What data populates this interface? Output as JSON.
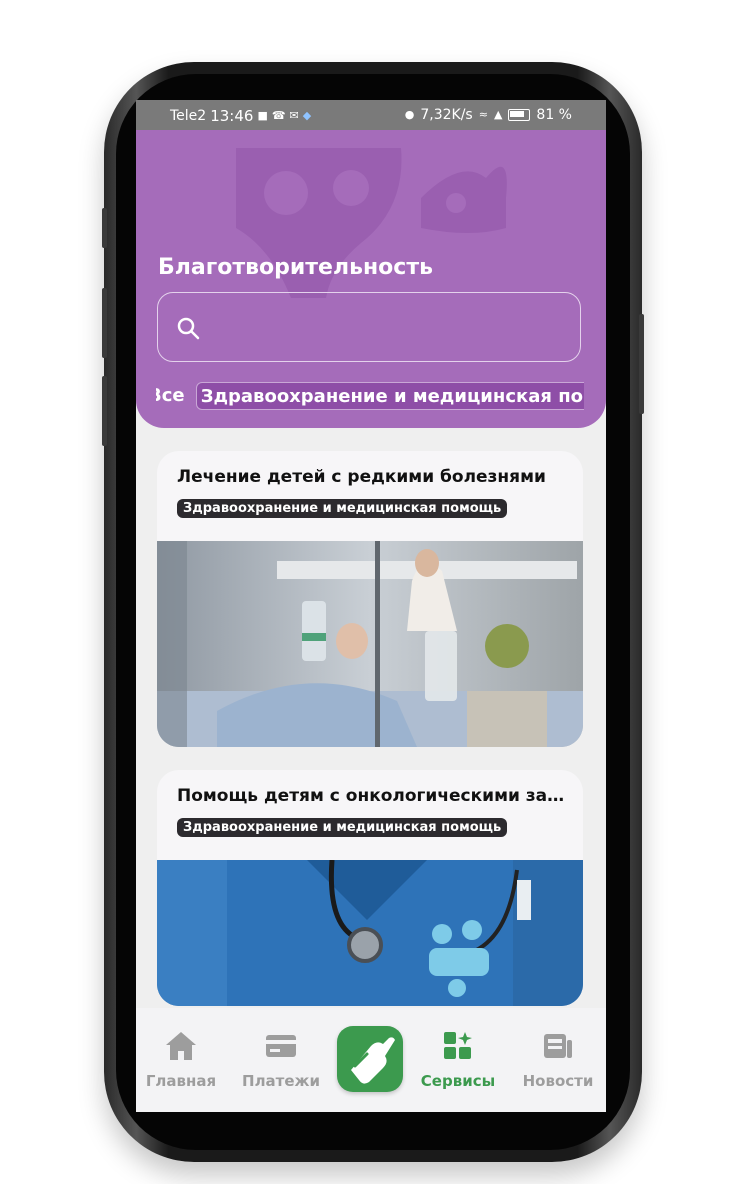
{
  "status_bar": {
    "carrier": "Tele2",
    "time": "13:46",
    "speed": "7,32K/s",
    "battery": "81 %"
  },
  "header": {
    "title": "Благотворительность",
    "search_placeholder": "",
    "colors": {
      "header_bg": "#a56cba",
      "active_chip_bg": "#8e4ea7"
    }
  },
  "categories": {
    "items": [
      "Все",
      "Здравоохранение и медицинская помощь"
    ],
    "active": "Здравоохранение и медицинская помощь"
  },
  "cards": [
    {
      "title": "Лечение детей с редкими болезнями",
      "tag": "Здравоохранение и медицинская помощь",
      "image": "hospital-iv-drip-photo"
    },
    {
      "title": "Помощь детям с онкологическими заболеваниями",
      "tag": "Здравоохранение и медицинская помощь",
      "image": "doctor-stethoscope-photo"
    }
  ],
  "bottom_nav": {
    "items": [
      {
        "label": "Главная",
        "icon": "home-icon"
      },
      {
        "label": "Платежи",
        "icon": "card-icon"
      },
      {
        "label": "Сервисы",
        "icon": "services-icon",
        "active": true
      },
      {
        "label": "Новости",
        "icon": "news-icon"
      }
    ],
    "center_icon": "app-hand-logo-icon",
    "colors": {
      "accent": "#3c9a4e",
      "inactive": "#9d9d9d"
    }
  }
}
